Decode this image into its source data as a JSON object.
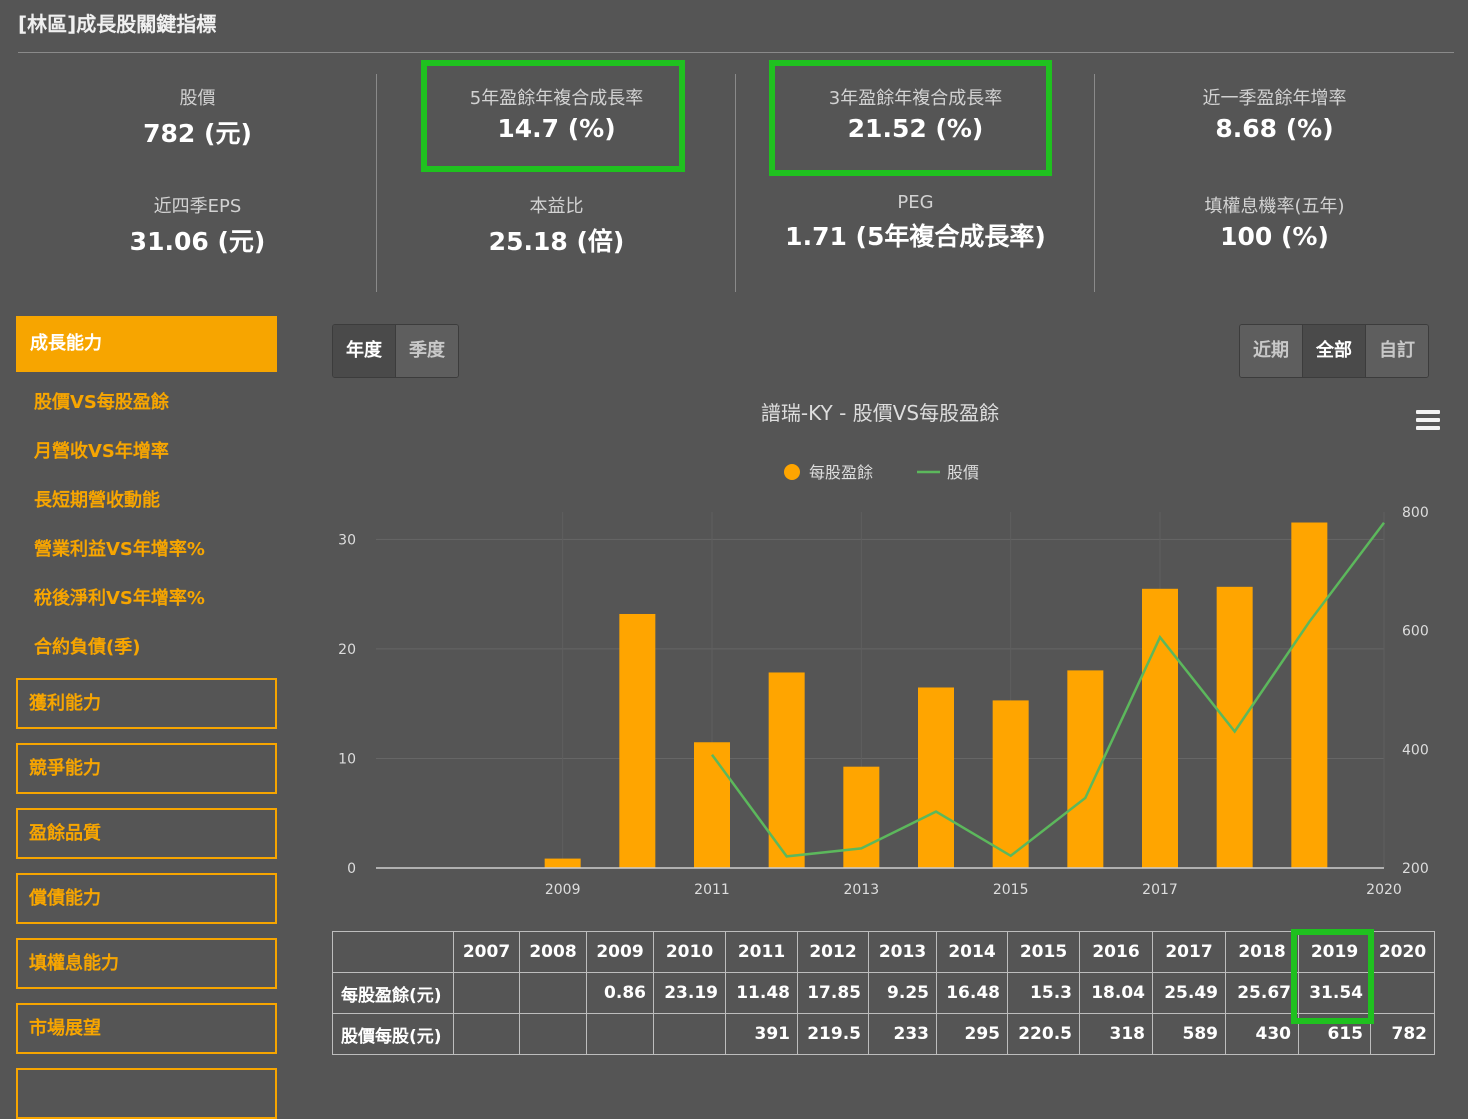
{
  "page": {
    "title": "[林區]成長股關鍵指標"
  },
  "metrics": {
    "col1": {
      "top": {
        "label": "股價",
        "value": "782 (元)"
      },
      "bottom": {
        "label": "近四季EPS",
        "value": "31.06 (元)"
      }
    },
    "col2": {
      "top": {
        "label": "5年盈餘年複合成長率",
        "value": "14.7 (%)"
      },
      "bottom": {
        "label": "本益比",
        "value": "25.18 (倍)"
      }
    },
    "col3": {
      "top": {
        "label": "3年盈餘年複合成長率",
        "value": "21.52 (%)"
      },
      "bottom": {
        "label": "PEG",
        "value": "1.71 (5年複合成長率)"
      }
    },
    "col4": {
      "top": {
        "label": "近一季盈餘年增率",
        "value": "8.68 (%)"
      },
      "bottom": {
        "label": "填權息機率(五年)",
        "value": "100 (%)"
      }
    }
  },
  "sidebar": {
    "active_section": "成長能力",
    "sub_items": [
      "股價VS每股盈餘",
      "月營收VS年增率",
      "長短期營收動能",
      "營業利益VS年增率%",
      "稅後淨利VS年增率%",
      "合約負債(季)"
    ],
    "sections": [
      "獲利能力",
      "競爭能力",
      "盈餘品質",
      "償債能力",
      "填權息能力",
      "市場展望"
    ]
  },
  "period_toggle": {
    "annual": "年度",
    "quarterly": "季度",
    "active": "annual"
  },
  "range_toggle": {
    "recent": "近期",
    "all": "全部",
    "custom": "自訂",
    "active": "all"
  },
  "colors": {
    "background": "#555555",
    "accent": "#f7a500",
    "eps_bar": "#ffa500",
    "price_line": "#5cb85c",
    "highlight": "#1fc11f"
  },
  "icons": {
    "chart_menu": "hamburger-menu-icon"
  },
  "chart_data": {
    "type": "bar",
    "title": "譜瑞-KY - 股價VS每股盈餘",
    "legend_position": "top-center",
    "x": [
      2007,
      2008,
      2009,
      2010,
      2011,
      2012,
      2013,
      2014,
      2015,
      2016,
      2017,
      2018,
      2019,
      2020
    ],
    "x_ticks": [
      "2009",
      "2011",
      "2013",
      "2015",
      "2017",
      "2020"
    ],
    "series": [
      {
        "name": "每股盈餘",
        "type": "bar",
        "axis": "left",
        "values": [
          null,
          null,
          0.86,
          23.19,
          11.48,
          17.85,
          9.25,
          16.48,
          15.3,
          18.04,
          25.49,
          25.67,
          31.54,
          null
        ]
      },
      {
        "name": "股價",
        "type": "line",
        "axis": "right",
        "values": [
          null,
          null,
          null,
          null,
          391,
          219.5,
          233,
          295,
          220.5,
          318,
          589,
          430,
          615,
          782
        ]
      }
    ],
    "y_left": {
      "ylim": [
        0,
        32.5
      ],
      "ticks": [
        0,
        10,
        20,
        30
      ]
    },
    "y_right": {
      "ylim": [
        200,
        800
      ],
      "ticks": [
        200,
        400,
        600,
        800
      ]
    },
    "grid": true
  },
  "table": {
    "years": [
      "2007",
      "2008",
      "2009",
      "2010",
      "2011",
      "2012",
      "2013",
      "2014",
      "2015",
      "2016",
      "2017",
      "2018",
      "2019",
      "2020"
    ],
    "rows": [
      {
        "label": "每股盈餘(元)",
        "values": [
          "",
          "",
          "0.86",
          "23.19",
          "11.48",
          "17.85",
          "9.25",
          "16.48",
          "15.3",
          "18.04",
          "25.49",
          "25.67",
          "31.54",
          ""
        ]
      },
      {
        "label": "股價每股(元)",
        "values": [
          "",
          "",
          "",
          "",
          "391",
          "219.5",
          "233",
          "295",
          "220.5",
          "318",
          "589",
          "430",
          "615",
          "782"
        ]
      }
    ]
  }
}
